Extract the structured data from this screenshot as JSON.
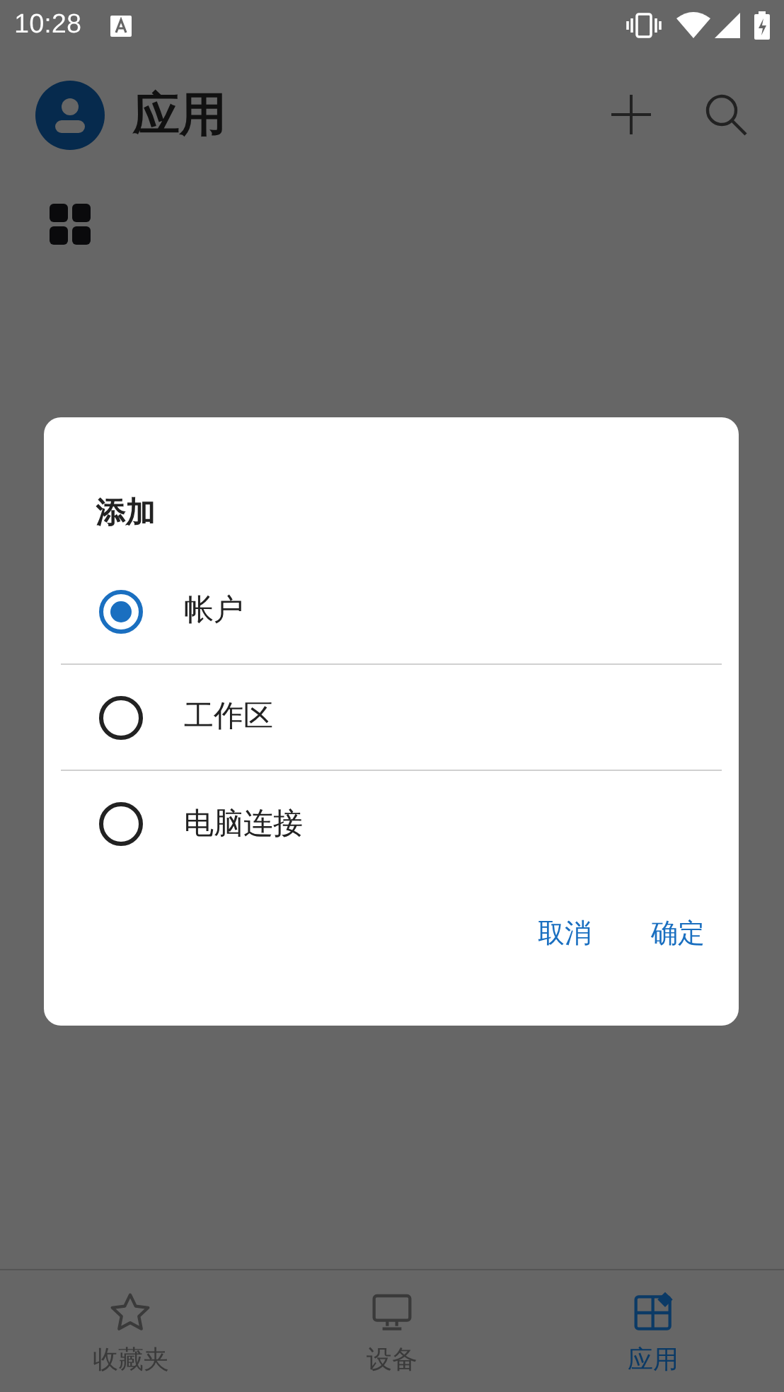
{
  "status_bar": {
    "time": "10:28"
  },
  "header": {
    "title": "应用"
  },
  "dialog": {
    "title": "添加",
    "options": [
      {
        "label": "帐户",
        "selected": true
      },
      {
        "label": "工作区",
        "selected": false
      },
      {
        "label": "电脑连接",
        "selected": false
      }
    ],
    "buttons": [
      "取消",
      "确定"
    ]
  },
  "bottom_nav": [
    {
      "label": "收藏夹",
      "kind": "star",
      "selected": false
    },
    {
      "label": "设备",
      "kind": "monitor",
      "selected": false
    },
    {
      "label": "应用",
      "kind": "apps",
      "selected": true
    }
  ]
}
